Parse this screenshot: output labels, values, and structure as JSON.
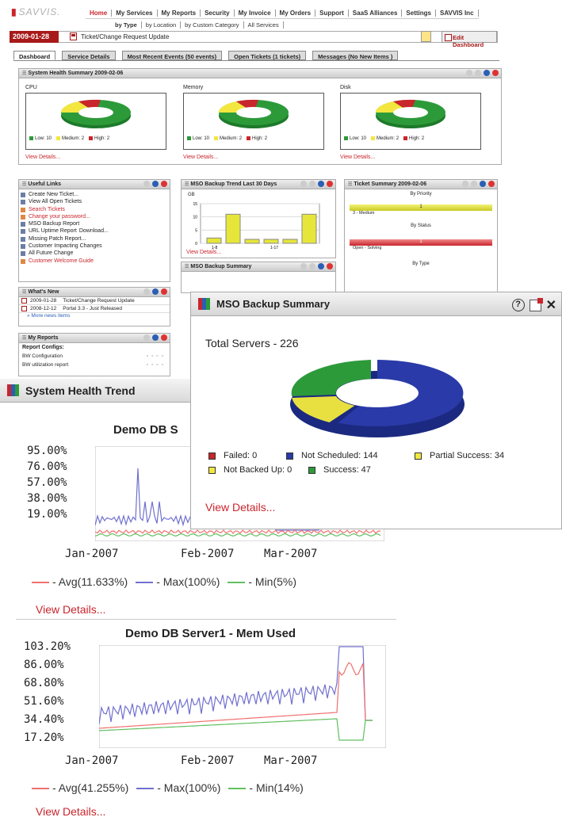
{
  "app": {
    "logo_text": "SAVVIS."
  },
  "nav": {
    "primary": [
      "Home",
      "My Services",
      "My Reports",
      "Security",
      "My Invoice",
      "My Orders",
      "Support",
      "SaaS Alliances",
      "Settings",
      "SAVVIS Inc"
    ],
    "secondary": [
      "by Type",
      "by Location",
      "by Custom Category",
      "All Services"
    ]
  },
  "toolbar": {
    "date": "2009-01-28",
    "ticket_label": "Ticket/Change Request Update",
    "edit_dashboard": "Edit Dashboard"
  },
  "tabs": [
    "Dashboard",
    "Service Details",
    "Most Recent Events (50 events)",
    "Open Tickets (1 tickets)",
    "Messages (No New Items )"
  ],
  "system_health": {
    "title": "System Health Summary 2009-02-06",
    "gauges": [
      {
        "label": "CPU",
        "low": "Low: 10",
        "medium": "Medium: 2",
        "high": "High: 2",
        "view": "View Details..."
      },
      {
        "label": "Memory",
        "low": "Low: 10",
        "medium": "Medium: 2",
        "high": "High: 2",
        "view": "View Details..."
      },
      {
        "label": "Disk",
        "low": "Low: 10",
        "medium": "Medium: 2",
        "high": "High: 2",
        "view": "View Details..."
      }
    ],
    "colors": {
      "low": "#2d9a3a",
      "medium": "#f3e73f",
      "high": "#c9252c"
    }
  },
  "useful_links": {
    "title": "Useful Links",
    "items": [
      {
        "label": "Create New Ticket...",
        "red": false
      },
      {
        "label": "View All Open Tickets",
        "red": false
      },
      {
        "label": "Search Tickets",
        "red": true
      },
      {
        "label": "Change your password...",
        "red": true
      },
      {
        "label": "MSO Backup Report",
        "red": false
      },
      {
        "label": "URL Uptime Report",
        "red": false,
        "extra": "Download..."
      },
      {
        "label": "Missing Patch Report...",
        "red": false
      },
      {
        "label": "Customer Impacting Changes",
        "red": false
      },
      {
        "label": "All Future Change",
        "red": false
      },
      {
        "label": "Customer Welcome Guide",
        "red": true
      }
    ]
  },
  "whats_new": {
    "title": "What's New",
    "items": [
      {
        "date": "2009-01-28",
        "text": "Ticket/Change Request Update"
      },
      {
        "date": "2008-12-12",
        "text": "Portal 3.3 - Just Released"
      }
    ],
    "more": "» More news items"
  },
  "my_reports": {
    "title": "My Reports",
    "section": "Report Configs:",
    "items": [
      "BW Configuration",
      "BW utilization report"
    ]
  },
  "mso_trend_small": {
    "title": "MSO Backup Trend Last 30 Days",
    "unit": "GB",
    "yticks": [
      "15",
      "10",
      "5",
      "0"
    ],
    "xticks": [
      "1-8",
      "1-17"
    ],
    "bar_values": [
      2,
      11,
      1.5,
      1.5,
      1.5,
      11
    ],
    "view": "View Details..."
  },
  "mso_summary_small": {
    "title": "MSO Backup Summary"
  },
  "ticket_summary": {
    "title": "Ticket Summary 2009-02-06",
    "priority_title": "By Priority",
    "priority_value": "1",
    "priority_label": "3 - Medium",
    "status_title": "By Status",
    "status_value": "1",
    "status_label": "Open - Solving",
    "type_title": "By Type"
  },
  "backup_summary": {
    "title": "MSO Backup Summary",
    "total": "Total Servers - 226",
    "legend": [
      {
        "label": "Failed: 0",
        "color": "#c9252c"
      },
      {
        "label": "Not Scheduled: 144",
        "color": "#2a3aa8"
      },
      {
        "label": "Partial Success: 34",
        "color": "#f3e73f"
      },
      {
        "label": "Not Backed Up: 0",
        "color": "#f3e73f"
      },
      {
        "label": "Success: 47",
        "color": "#2d9a3a"
      }
    ],
    "view": "View Details..."
  },
  "system_trend": {
    "title": "System Health Trend",
    "chart1_title": "Demo DB S",
    "chart1_yticks": [
      "95.00%",
      "76.00%",
      "57.00%",
      "38.00%",
      "19.00%"
    ],
    "chart2_title": "Demo DB Server1 - Mem Used",
    "chart2_yticks": [
      "103.20%",
      "86.00%",
      "68.80%",
      "51.60%",
      "34.40%",
      "17.20%"
    ],
    "xticks": [
      "Jan-2007",
      "Feb-2007",
      "Mar-2007"
    ],
    "legend1": [
      {
        "label": "- Avg(11.633%)",
        "color": "#f07070"
      },
      {
        "label": "- Max(100%)",
        "color": "#7070d0"
      },
      {
        "label": "- Min(5%)",
        "color": "#60c060"
      }
    ],
    "legend2": [
      {
        "label": "- Avg(41.255%)",
        "color": "#f07070"
      },
      {
        "label": "- Max(100%)",
        "color": "#7070d0"
      },
      {
        "label": "- Min(14%)",
        "color": "#60c060"
      }
    ],
    "view": "View Details..."
  }
}
